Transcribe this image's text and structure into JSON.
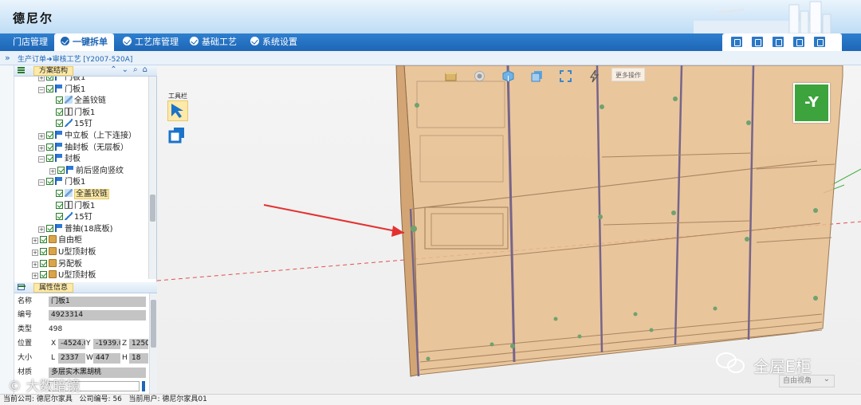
{
  "app": {
    "title": "德尼尔"
  },
  "nav": {
    "items": [
      {
        "label": "门店管理"
      },
      {
        "label": "一键拆单"
      },
      {
        "label": "工艺库管理"
      },
      {
        "label": "基础工艺"
      },
      {
        "label": "系统设置"
      }
    ]
  },
  "breadcrumb": {
    "part1": "生产订单",
    "arrow": "➜",
    "part2": "审核工艺 [Y2007-520A]"
  },
  "tree_panel": {
    "title": "方案结构",
    "nodes": [
      {
        "label": "门板1",
        "type": "flag"
      },
      {
        "label": "门板1",
        "type": "flag"
      },
      {
        "label": "全盖铰链",
        "type": "hinge"
      },
      {
        "label": "门板1",
        "type": "door"
      },
      {
        "label": "15钉",
        "type": "nail"
      },
      {
        "label": "中立板（上下连接）",
        "type": "flag"
      },
      {
        "label": "抽封板（无层板）",
        "type": "flag"
      },
      {
        "label": "封板",
        "type": "flag"
      },
      {
        "label": "前后竖向竖纹",
        "type": "flag"
      },
      {
        "label": "门板1",
        "type": "flag"
      },
      {
        "label": "全盖铰链",
        "type": "hinge",
        "selected": true
      },
      {
        "label": "门板1",
        "type": "door"
      },
      {
        "label": "15钉",
        "type": "nail"
      },
      {
        "label": "普抽(18底板)",
        "type": "flag"
      },
      {
        "label": "自由柜",
        "type": "box"
      },
      {
        "label": "U型顶封板",
        "type": "box"
      },
      {
        "label": "另配板",
        "type": "box"
      },
      {
        "label": "U型顶封板",
        "type": "box"
      }
    ]
  },
  "props_panel": {
    "title": "属性信息",
    "name_label": "名称",
    "name_value": "门板1",
    "code_label": "编号",
    "code_value": "4923314",
    "type_label": "类型",
    "type_value": "498",
    "pos_label": "位置",
    "x_label": "X",
    "x_value": "-4524.0",
    "y_label": "Y",
    "y_value": "-1939.0",
    "z_label": "Z",
    "z_value": "1250",
    "size_label": "大小",
    "l_label": "L",
    "l_value": "2337",
    "w_label": "W",
    "w_value": "447",
    "h_label": "H",
    "h_value": "18",
    "material_label": "材质",
    "material_value": "多层实木黑胡桃"
  },
  "viewport": {
    "toolbar_title": "工具栏",
    "more_ops": "更多操作",
    "axis_label": "-Y",
    "view_select": "自由视角"
  },
  "watermark": {
    "text": "全屋E柜",
    "text2": "大数暗镜"
  },
  "status": {
    "company_label": "当前公司:",
    "company_value": "德尼尔家具",
    "code_label": "公司编号:",
    "code_value": "56",
    "user_label": "当前用户:",
    "user_value": "德尼尔家具01"
  },
  "colors": {
    "nav_blue": "#1e66b6",
    "selection_yellow": "#fde9a8",
    "axis_green": "#3da33d",
    "cabinet": "#e7bd8d"
  }
}
